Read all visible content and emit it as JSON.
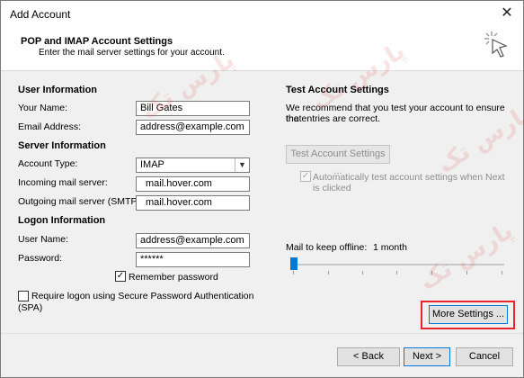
{
  "window": {
    "title": "Add Account",
    "close_glyph": "✕"
  },
  "header": {
    "title": "POP and IMAP Account Settings",
    "subtitle": "Enter the mail server settings for your account."
  },
  "user_info": {
    "section_title": "User Information",
    "your_name_label": "Your Name:",
    "your_name_value": "Bill Gates",
    "email_label": "Email Address:",
    "email_value": "address@example.com"
  },
  "server_info": {
    "section_title": "Server Information",
    "account_type_label": "Account Type:",
    "account_type_value": "IMAP",
    "incoming_label": "Incoming mail server:",
    "incoming_value": "mail.hover.com",
    "outgoing_label": "Outgoing mail server (SMTP):",
    "outgoing_value": "mail.hover.com"
  },
  "logon_info": {
    "section_title": "Logon Information",
    "user_name_label": "User Name:",
    "user_name_value": "address@example.com",
    "password_label": "Password:",
    "password_value": "******",
    "remember_password_label": "Remember password",
    "remember_password_checked": "✓",
    "spa_label_line1": "Require logon using Secure Password Authentication",
    "spa_label_line2": "(SPA)"
  },
  "test_settings": {
    "section_title": "Test Account Settings",
    "description_line1": "We recommend that you test your account to ensure that",
    "description_line2": "the entries are correct.",
    "test_button_label": "Test Account Settings ...",
    "auto_test_label_line1": "Automatically test account settings when Next",
    "auto_test_label_line2": "is clicked",
    "auto_test_checked": "✓"
  },
  "offline": {
    "label": "Mail to keep offline:",
    "value": "1 month"
  },
  "more_settings_label": "More Settings ...",
  "footer": {
    "back_label": "< Back",
    "next_label": "Next >",
    "cancel_label": "Cancel"
  },
  "watermark_text": "پارس تک",
  "accent_color": "#0078d7",
  "highlight_color": "#e4262a"
}
